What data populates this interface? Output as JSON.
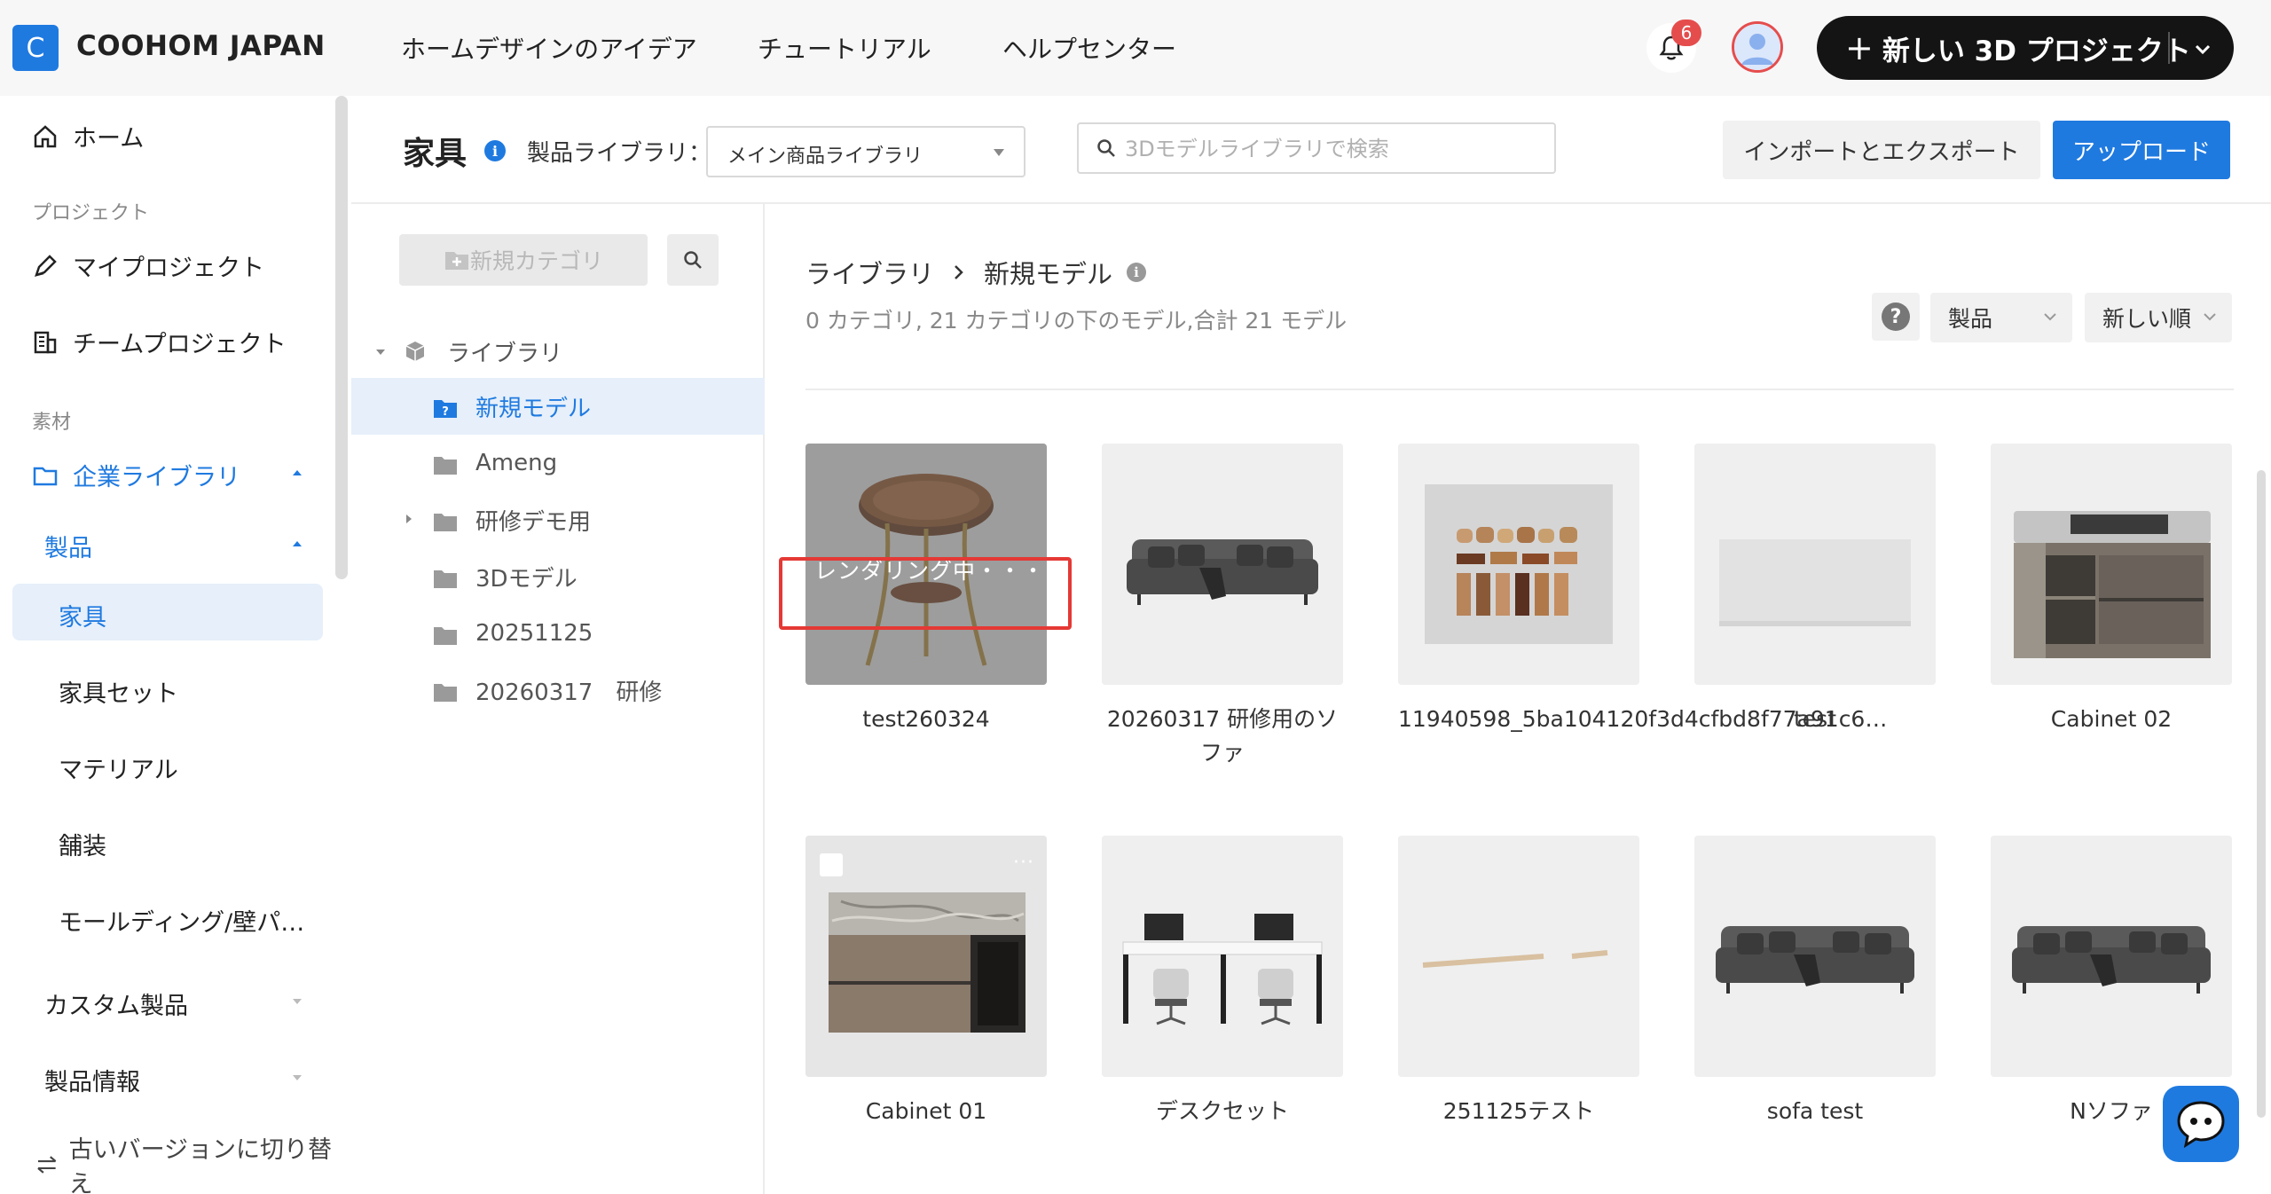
{
  "header": {
    "logo_letter": "C",
    "brand": "COOHOM JAPAN",
    "nav": [
      "ホームデザインのアイデア",
      "チュートリアル",
      "ヘルプセンター"
    ],
    "notification_count": "6",
    "new_project_label": "新しい 3D プロジェクト",
    "accent_color": "#1f7ae0"
  },
  "sidebar": {
    "home": "ホーム",
    "section_project": "プロジェクト",
    "my_projects": "マイプロジェクト",
    "team_projects": "チームプロジェクト",
    "section_material": "素材",
    "enterprise_library": "企業ライブラリ",
    "products": "製品",
    "sub_items": [
      "家具",
      "家具セット",
      "マテリアル",
      "舗装",
      "モールディング/壁パ…"
    ],
    "custom_products": "カスタム製品",
    "product_info": "製品情報",
    "switch_version": "古いバージョンに切り替え"
  },
  "main": {
    "title": "家具",
    "library_label": "製品ライブラリ：",
    "library_selected": "メイン商品ライブラリ",
    "search_placeholder": "3Dモデルライブラリで検索",
    "import_export": "インポートとエクスポート",
    "upload": "アップロード"
  },
  "categories": {
    "new_category": "新規カテゴリ",
    "tree": [
      "ライブラリ",
      "新規モデル",
      "Ameng",
      "研修デモ用",
      "3Dモデル",
      "20251125",
      "20260317　研修"
    ]
  },
  "content": {
    "breadcrumb_root": "ライブラリ",
    "breadcrumb_current": "新規モデル",
    "summary": "0 カテゴリ, 21 カテゴリの下のモデル,合計 21 モデル",
    "filter_type": "製品",
    "sort": "新しい順",
    "rendering_text": "レンダリング中・・・",
    "cards": [
      {
        "name": "test260324",
        "icon": "round-table"
      },
      {
        "name": "20260317 研修用のソファ",
        "icon": "sofa"
      },
      {
        "name": "11940598_5ba104120f3d4cfbd8f77a91c6…",
        "icon": "panel-samples"
      },
      {
        "name": "test",
        "icon": "blank-panel"
      },
      {
        "name": "Cabinet 02",
        "icon": "cabinet-sink"
      },
      {
        "name": "Cabinet 01",
        "icon": "cabinet-marble"
      },
      {
        "name": "デスクセット",
        "icon": "desk-set"
      },
      {
        "name": "251125テスト",
        "icon": "molding-strip"
      },
      {
        "name": "sofa test",
        "icon": "sofa"
      },
      {
        "name": "Nソファ",
        "icon": "sofa"
      }
    ]
  }
}
